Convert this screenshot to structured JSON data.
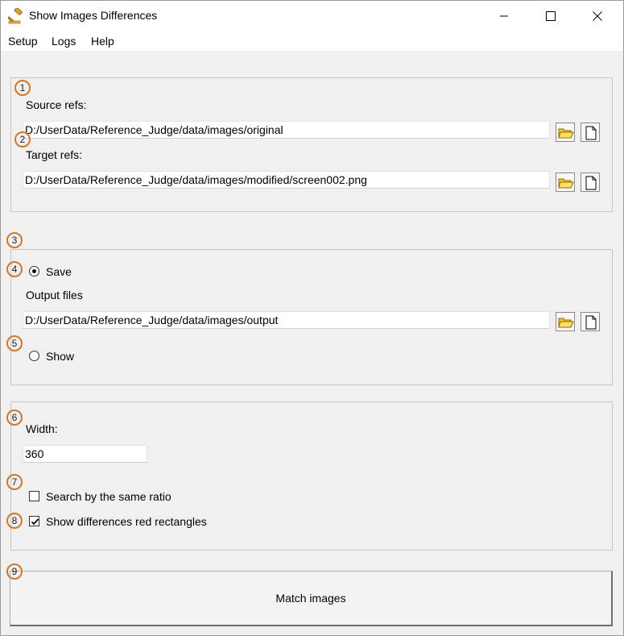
{
  "window": {
    "title": "Show Images Differences"
  },
  "menu": {
    "items": [
      "Setup",
      "Logs",
      "Help"
    ]
  },
  "markers": [
    "1",
    "2",
    "3",
    "4",
    "5",
    "6",
    "7",
    "8",
    "9"
  ],
  "refs": {
    "source_label": "Source refs:",
    "source_value": "D:/UserData/Reference_Judge/data/images/original",
    "target_label": "Target refs:",
    "target_value": "D:/UserData/Reference_Judge/data/images/modified/screen002.png"
  },
  "output": {
    "save_label": "Save",
    "save_selected": true,
    "output_files_label": "Output files",
    "output_value": "D:/UserData/Reference_Judge/data/images/output",
    "show_label": "Show",
    "show_selected": false
  },
  "settings": {
    "width_label": "Width:",
    "width_value": "360",
    "same_ratio_label": "Search by the same ratio",
    "same_ratio_checked": false,
    "red_rect_label": "Show differences red rectangles",
    "red_rect_checked": true
  },
  "actions": {
    "match_label": "Match images"
  },
  "icons": {
    "app": "gavel-icon",
    "folder": "open-folder-icon",
    "file": "new-file-icon"
  },
  "colors": {
    "marker_border": "#d1782b",
    "window_bg": "#f0f0f0",
    "folder_yellow": "#f5c518"
  }
}
